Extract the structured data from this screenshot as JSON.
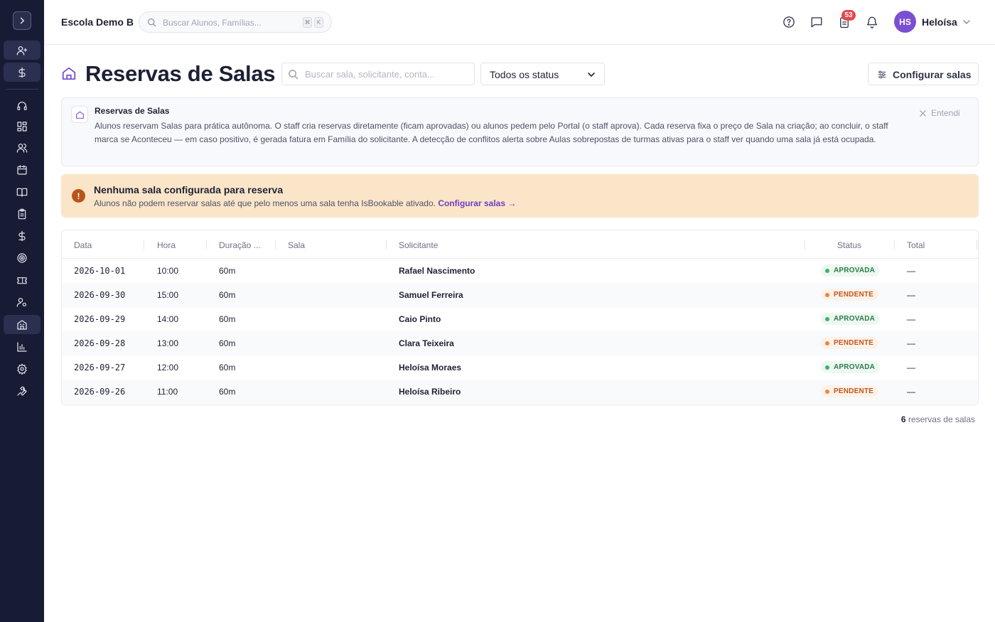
{
  "header": {
    "school_name": "Escola Demo B",
    "search_placeholder": "Buscar Alunos, Famílias...",
    "kbd_1": "⌘",
    "kbd_2": "K",
    "notification_badge": "53",
    "user_initials": "HS",
    "user_name": "Heloísa"
  },
  "page": {
    "title": "Reservas de Salas",
    "search_placeholder": "Buscar sala, solicitante, conta...",
    "status_filter": "Todos os status",
    "config_button": "Configurar salas"
  },
  "info_box": {
    "title": "Reservas de Salas",
    "text": "Alunos reservam Salas para prática autônoma. O staff cria reservas diretamente (ficam aprovadas) ou alunos pedem pelo Portal (o staff aprova). Cada reserva fixa o preço de Sala na criação; ao concluir, o staff marca se Aconteceu — em caso positivo, é gerada fatura em Família do solicitante. A detecção de conflitos alerta sobre Aulas sobrepostas de turmas ativas para o staff ver quando uma sala já está ocupada.",
    "dismiss": "Entendi"
  },
  "warning": {
    "icon": "!",
    "title": "Nenhuma sala configurada para reserva",
    "text": "Alunos não podem reservar salas até que pelo menos uma sala tenha IsBookable ativado.",
    "link": "Configurar salas →"
  },
  "table": {
    "columns": [
      "Data",
      "Hora",
      "Duração ...",
      "Sala",
      "Solicitante",
      "Status",
      "Total"
    ],
    "rows": [
      {
        "date": "2026-10-01",
        "time": "10:00",
        "duration": "60m",
        "room": "",
        "requester": "Rafael Nascimento",
        "status": "APROVADA",
        "total": "—"
      },
      {
        "date": "2026-09-30",
        "time": "15:00",
        "duration": "60m",
        "room": "",
        "requester": "Samuel Ferreira",
        "status": "PENDENTE",
        "total": "—"
      },
      {
        "date": "2026-09-29",
        "time": "14:00",
        "duration": "60m",
        "room": "",
        "requester": "Caio Pinto",
        "status": "APROVADA",
        "total": "—"
      },
      {
        "date": "2026-09-28",
        "time": "13:00",
        "duration": "60m",
        "room": "",
        "requester": "Clara Teixeira",
        "status": "PENDENTE",
        "total": "—"
      },
      {
        "date": "2026-09-27",
        "time": "12:00",
        "duration": "60m",
        "room": "",
        "requester": "Heloísa Moraes",
        "status": "APROVADA",
        "total": "—"
      },
      {
        "date": "2026-09-26",
        "time": "11:00",
        "duration": "60m",
        "room": "",
        "requester": "Heloísa Ribeiro",
        "status": "PENDENTE",
        "total": "—"
      }
    ]
  },
  "footer": {
    "count": "6",
    "count_label": "reservas de salas"
  },
  "colors": {
    "sidebar_bg": "#181b34",
    "accent": "#7b4fd2",
    "warning_bg": "#fbe5c9",
    "approved": "#3bb26b",
    "pending": "#f0843c"
  }
}
